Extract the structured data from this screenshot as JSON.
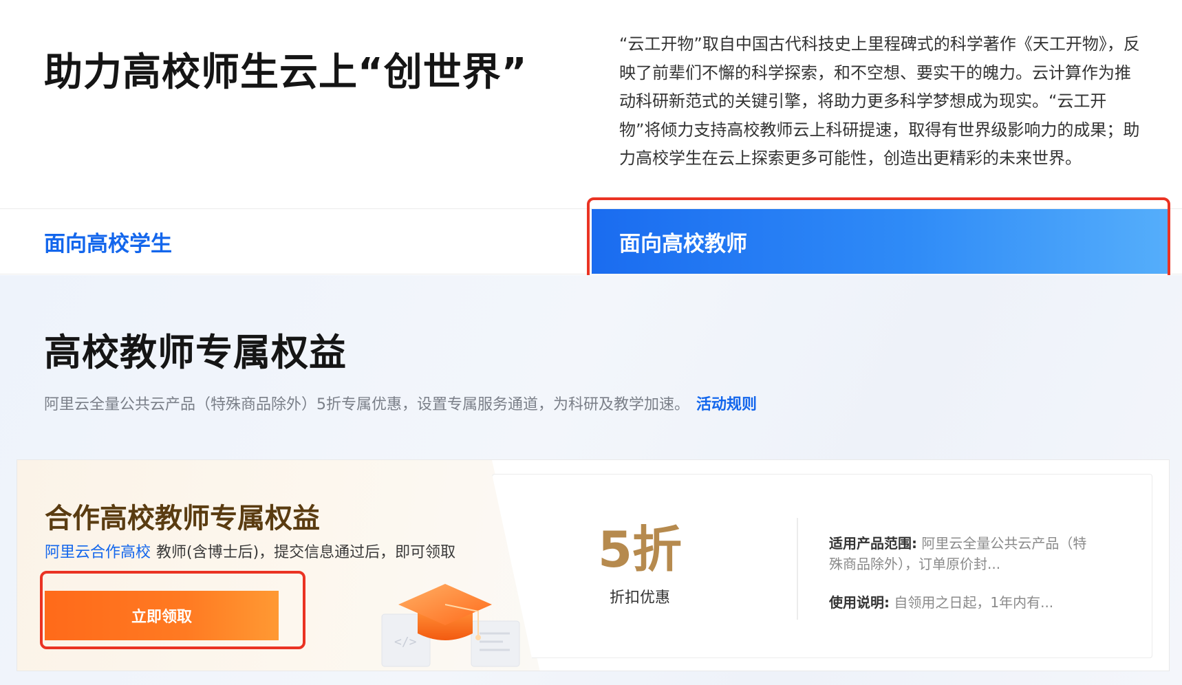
{
  "hero": {
    "title": "助力高校师生云上“创世界”",
    "description": "“云工开物”取自中国古代科技史上里程碑式的科学著作《天工开物》，反映了前辈们不懈的科学探索，和不空想、要实干的魄力。云计算作为推动科研新范式的关键引擎，将助力更多科学梦想成为现实。“云工开物”将倾力支持高校教师云上科研提速，取得有世界级影响力的成果；助力高校学生在云上探索更多可能性，创造出更精彩的未来世界。"
  },
  "tabs": {
    "students": "面向高校学生",
    "teachers": "面向高校教师",
    "active": "teachers"
  },
  "section": {
    "title": "高校教师专属权益",
    "subtitle": "阿里云全量公共云产品（特殊商品除外）5折专属优惠，设置专属服务通道，为科研及教学加速。",
    "rules_link": "活动规则"
  },
  "card": {
    "title": "合作高校教师专属权益",
    "partner_link": "阿里云合作高校",
    "desc": "教师(含博士后)，提交信息通过后，即可领取",
    "button": "立即领取",
    "discount_value": "5折",
    "discount_label": "折扣优惠",
    "scope_label": "适用产品范围:",
    "scope_text": "阿里云全量公共云产品（特殊商品除外），订单原价封...",
    "usage_label": "使用说明:",
    "usage_text": "自领用之日起，1年内有..."
  },
  "colors": {
    "accent_blue": "#1366ec",
    "tab_active_gradient_start": "#1a6cf0",
    "tab_active_gradient_end": "#55aefb",
    "button_orange": "#ff6a1a",
    "discount_gold": "#b68a4e",
    "highlight_red": "#ea3323"
  },
  "icons": [
    "graduation-cap-icon"
  ]
}
